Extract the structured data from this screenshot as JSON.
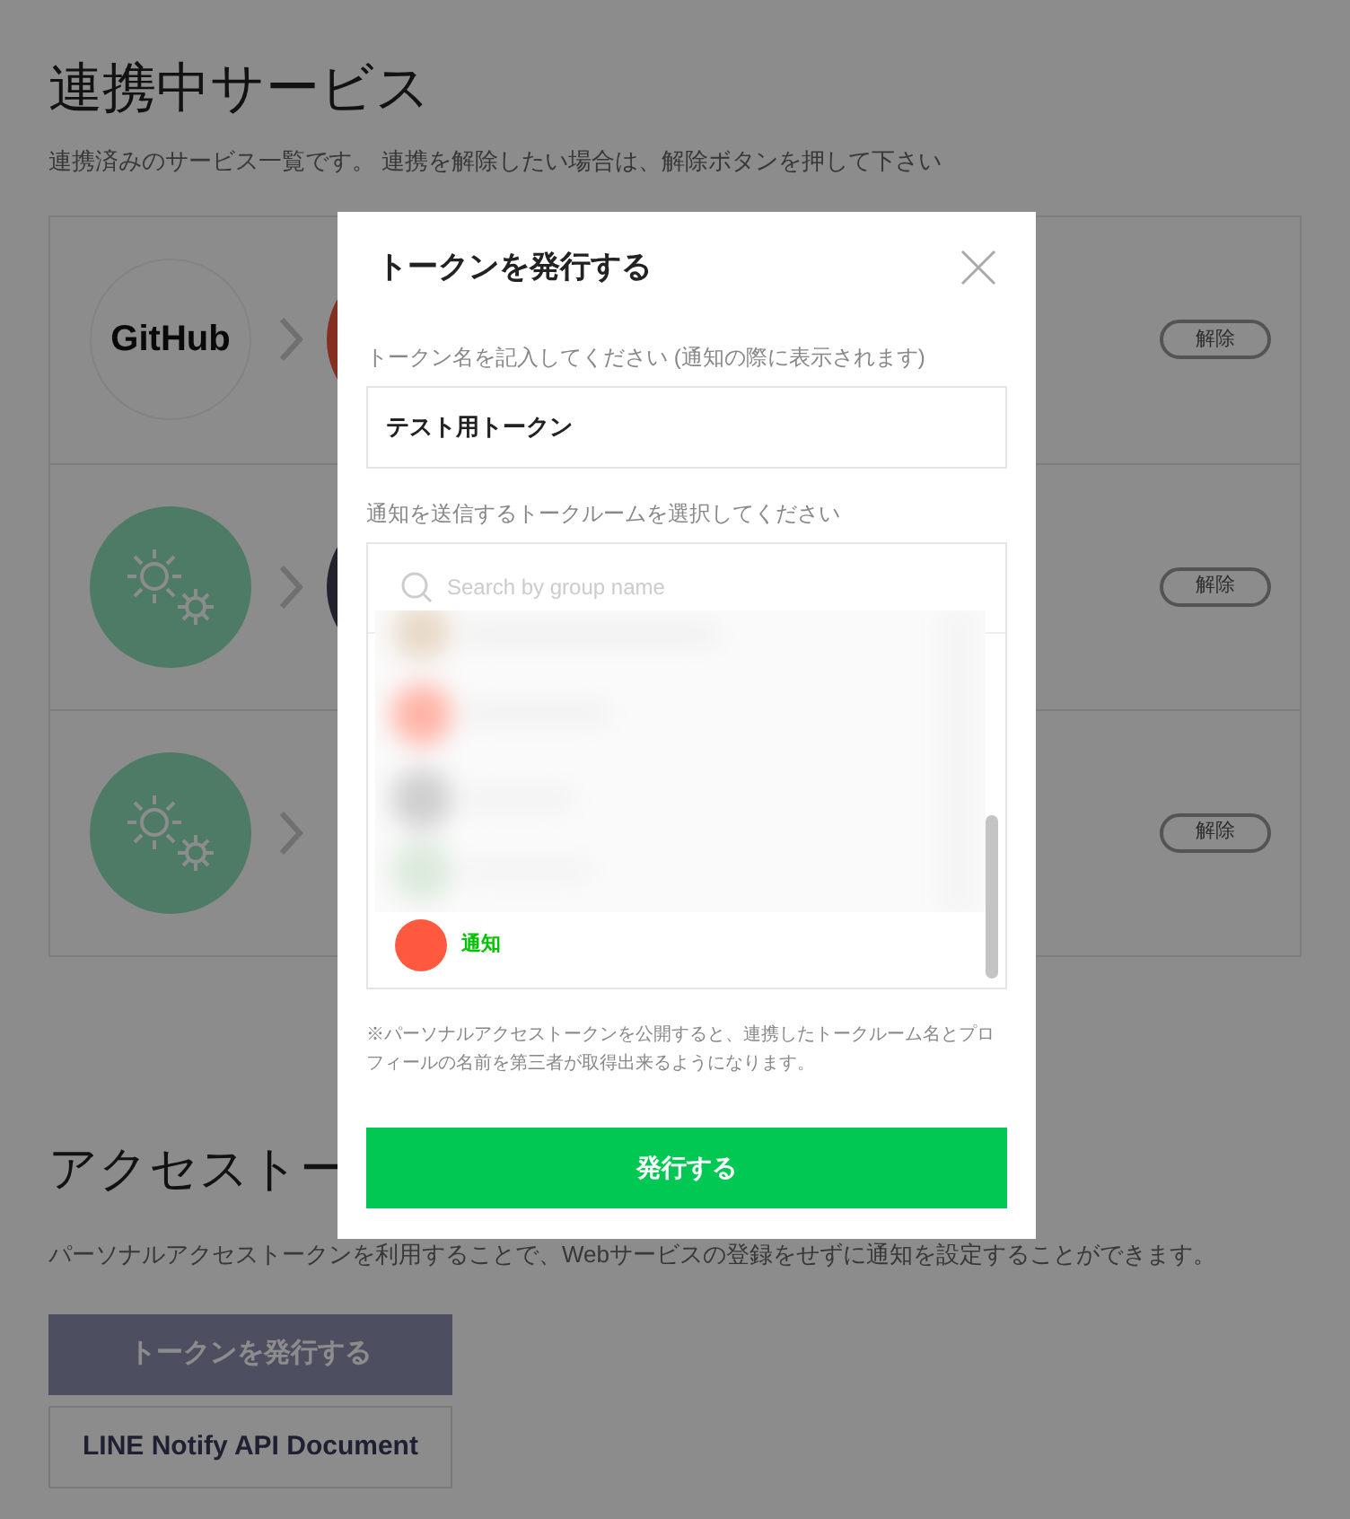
{
  "page": {
    "title": "連携中サービス",
    "subtitle": "連携済みのサービス一覧です。 連携を解除したい場合は、解除ボタンを押して下さい",
    "services": [
      {
        "kind": "github",
        "logo_text": "GitHub",
        "target": {
          "kind": "notify"
        },
        "button": "解除"
      },
      {
        "kind": "gears",
        "target": {
          "kind": "room"
        },
        "button": "解除"
      },
      {
        "kind": "gears",
        "button": "解除"
      }
    ],
    "access": {
      "title": "アクセストー",
      "description": "パーソナルアクセストークンを利用することで、Webサービスの登録をせずに通知を設定することができます。",
      "issue_button": "トークンを発行する",
      "doc_button": "LINE Notify API Document"
    }
  },
  "modal": {
    "title": "トークンを発行する",
    "name_label": "トークン名を記入してください (通知の際に表示されます)",
    "name_value": "テスト用トークン",
    "room_label": "通知を送信するトークルームを選択してください",
    "search": {
      "placeholder": "Search by group name"
    },
    "rooms": [
      {
        "name": "通知",
        "color": "#ff5a40",
        "selected": true
      }
    ],
    "notice": "※パーソナルアクセストークンを公開すると、連携したトークルーム名とプロフィールの名前を第三者が取得出来るようになります。",
    "submit": "発行する"
  }
}
